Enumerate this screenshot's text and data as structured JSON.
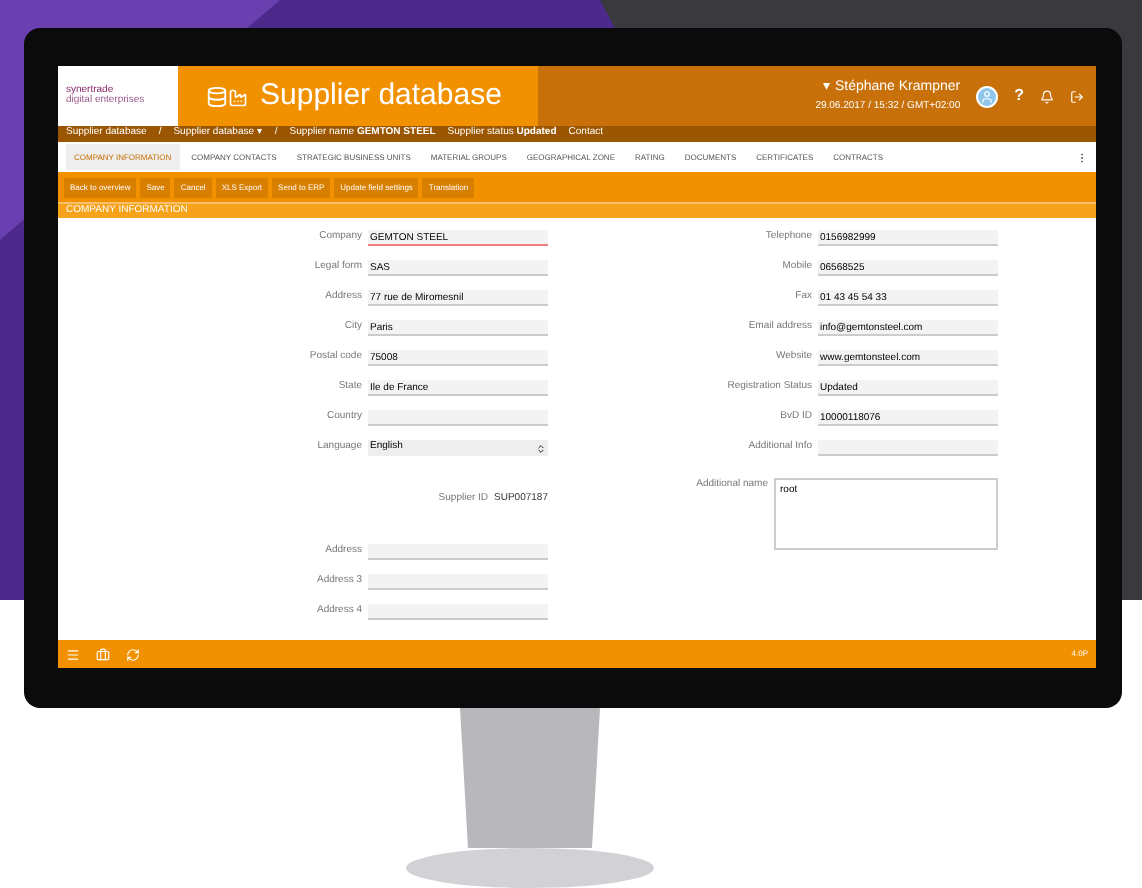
{
  "header": {
    "logo_text": "synertrade",
    "logo_tagline": "digital enterprises",
    "title": "Supplier database",
    "menu_caret": "▾",
    "user_name": "Stéphane Krampner",
    "user_meta": "29.06.2017 / 15:32 / GMT+02:00",
    "help": "?"
  },
  "breadcrumb": [
    {
      "text": "Supplier database"
    },
    {
      "text": "/"
    },
    {
      "text": "Supplier database ▾"
    },
    {
      "text": "/"
    },
    {
      "text": "Supplier name **GEMTON STEEL**"
    },
    {
      "text": "Supplier status **Updated**"
    },
    {
      "text": "Contact"
    }
  ],
  "tabs": [
    {
      "label": "COMPANY INFORMATION",
      "selected": true
    },
    {
      "label": "COMPANY CONTACTS",
      "selected": false
    },
    {
      "label": "STRATEGIC BUSINESS UNITS",
      "selected": false
    },
    {
      "label": "MATERIAL GROUPS",
      "selected": false
    },
    {
      "label": "GEOGRAPHICAL ZONE",
      "selected": false
    },
    {
      "label": "RATING",
      "selected": false
    },
    {
      "label": "DOCUMENTS",
      "selected": false
    },
    {
      "label": "CERTIFICATES",
      "selected": false
    },
    {
      "label": "CONTRACTS",
      "selected": false
    }
  ],
  "toolbar": [
    "Back to overview",
    "Save",
    "Cancel",
    "XLS Export",
    "Send to ERP",
    "Update field settings",
    "Translation"
  ],
  "section_title": "COMPANY INFORMATION",
  "left_groups": [
    [
      {
        "kind": "text",
        "label": "Company",
        "value": "GEMTON STEEL",
        "invalid": true
      },
      {
        "kind": "text",
        "label": "Legal form",
        "value": "SAS",
        "invalid": false
      },
      {
        "kind": "text",
        "label": "Address",
        "value": "77 rue de Miromesnil",
        "invalid": false
      },
      {
        "kind": "text",
        "label": "City",
        "value": "Paris",
        "invalid": false
      },
      {
        "kind": "text",
        "label": "Postal code",
        "value": "75008",
        "invalid": false
      },
      {
        "kind": "text",
        "label": "State",
        "value": "Ile de France",
        "invalid": false
      },
      {
        "kind": "text",
        "label": "Country",
        "invalid": false
      },
      {
        "kind": "select",
        "label": "Language",
        "value": "English"
      }
    ],
    [
      {
        "kind": "static",
        "label": "Supplier ID",
        "value": "SUP007187"
      }
    ],
    [
      {
        "kind": "text",
        "label": "Address",
        "invalid": false
      },
      {
        "kind": "text",
        "label": "Address 3",
        "invalid": false
      },
      {
        "kind": "text",
        "label": "Address 4",
        "invalid": false
      }
    ]
  ],
  "right_fields": [
    {
      "kind": "text",
      "label": "Telephone",
      "value": "0156982999",
      "invalid": false
    },
    {
      "kind": "text",
      "label": "Mobile",
      "value": "06568525",
      "invalid": false
    },
    {
      "kind": "text",
      "label": "Fax",
      "value": "01 43 45 54 33",
      "invalid": false
    },
    {
      "kind": "text",
      "label": "Email address",
      "value": "info@gemtonsteel.com",
      "invalid": false
    },
    {
      "kind": "text",
      "label": "Website",
      "value": "www.gemtonsteel.com",
      "invalid": false
    },
    {
      "kind": "text",
      "label": "Registration Status",
      "value": "Updated",
      "invalid": false
    },
    {
      "kind": "text",
      "label": "BvD ID",
      "value": "10000118076",
      "invalid": false
    },
    {
      "kind": "text",
      "label": "Additional Info",
      "invalid": false
    },
    {
      "kind": "textarea",
      "label": "Additional name",
      "value": "root",
      "invalid": false
    }
  ],
  "footer": {
    "version": "4.0P"
  }
}
